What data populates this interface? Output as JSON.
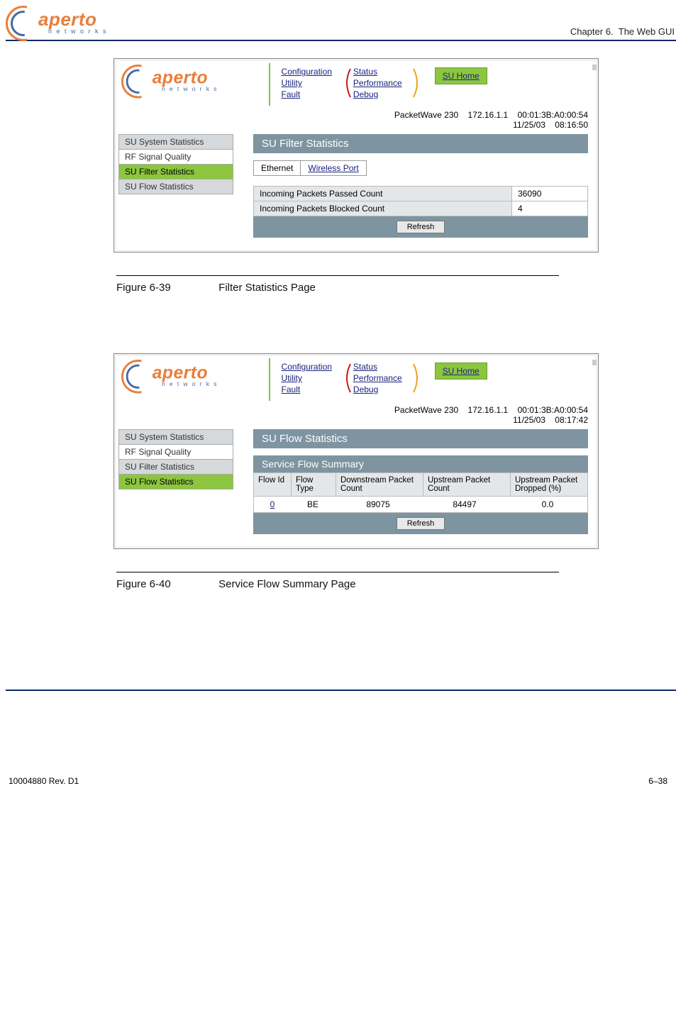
{
  "header": {
    "logo_text": "aperto",
    "logo_sub": "n e t w o r k s",
    "chapter_label": "Chapter 6.",
    "chapter_title": "The Web GUI"
  },
  "nav": {
    "col1": [
      "Configuration",
      "Utility",
      "Fault"
    ],
    "col2": [
      "Status",
      "Performance",
      "Debug"
    ],
    "su_home": "SU Home"
  },
  "fig1": {
    "info": {
      "device": "PacketWave 230",
      "ip": "172.16.1.1",
      "mac": "00:01:3B:A0:00:54",
      "date": "11/25/03",
      "time": "08:16:50"
    },
    "sidebar": [
      "SU System Statistics",
      "RF Signal Quality",
      "SU Filter Statistics",
      "SU Flow Statistics"
    ],
    "active_index": 2,
    "banner": "SU Filter Statistics",
    "tabs": {
      "active": "Ethernet",
      "other": "Wireless Port"
    },
    "rows": [
      {
        "label": "Incoming Packets Passed Count",
        "value": "36090"
      },
      {
        "label": "Incoming Packets Blocked Count",
        "value": "4"
      }
    ],
    "refresh": "Refresh",
    "caption_num": "Figure 6-39",
    "caption_text": "Filter Statistics Page"
  },
  "fig2": {
    "info": {
      "device": "PacketWave 230",
      "ip": "172.16.1.1",
      "mac": "00:01:3B:A0:00:54",
      "date": "11/25/03",
      "time": "08:17:42"
    },
    "sidebar": [
      "SU System Statistics",
      "RF Signal Quality",
      "SU Filter Statistics",
      "SU Flow Statistics"
    ],
    "active_index": 3,
    "banner": "SU Flow Statistics",
    "subbanner": "Service Flow Summary",
    "cols": [
      "Flow Id",
      "Flow Type",
      "Downstream Packet Count",
      "Upstream Packet Count",
      "Upstream Packet Dropped (%)"
    ],
    "row": {
      "id": "0",
      "type": "BE",
      "ds": "89075",
      "us": "84497",
      "drop": "0.0"
    },
    "refresh": "Refresh",
    "caption_num": "Figure 6-40",
    "caption_text": "Service Flow Summary Page"
  },
  "footer": {
    "left": "10004880 Rev. D1",
    "right": "6–38"
  }
}
